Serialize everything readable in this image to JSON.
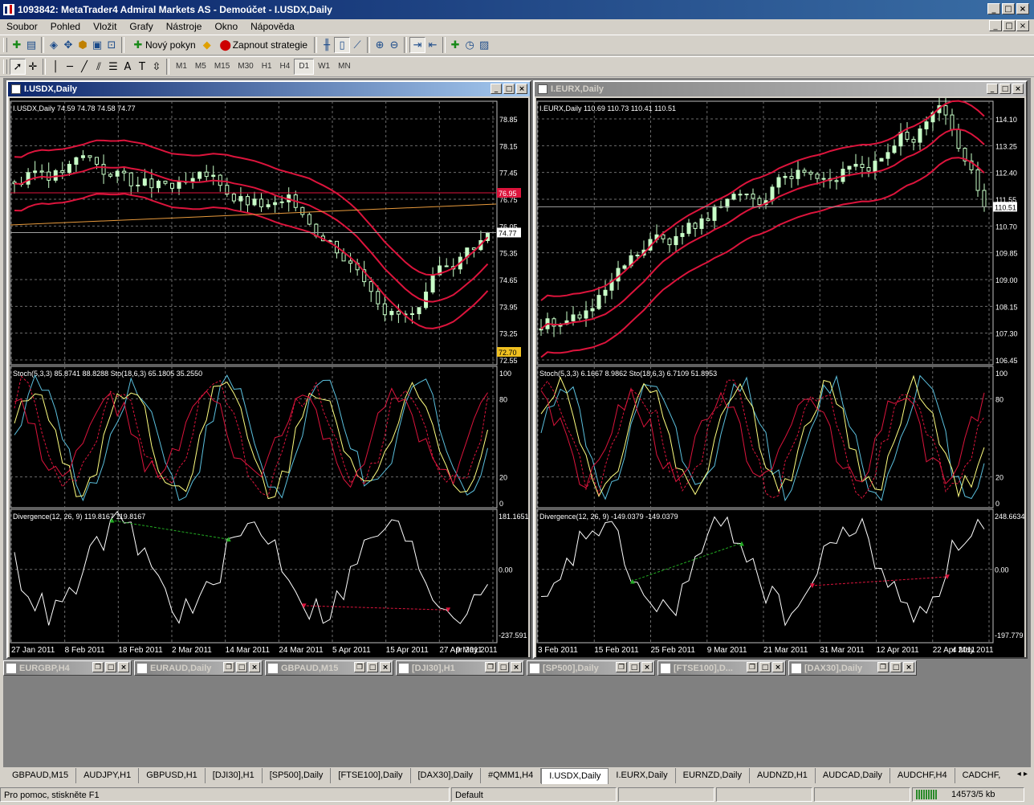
{
  "window": {
    "title": "1093842: MetaTrader4 Admiral Markets AS - Demoúčet - I.USDX,Daily"
  },
  "menu": [
    "Soubor",
    "Pohled",
    "Vložit",
    "Grafy",
    "Nástroje",
    "Okno",
    "Nápověda"
  ],
  "toolbar": {
    "new_order": "Nový pokyn",
    "strategy": "Zapnout strategie"
  },
  "drawing_toolbar": {
    "text_tool": "A"
  },
  "timeframes": [
    "M1",
    "M5",
    "M15",
    "M30",
    "H1",
    "H4",
    "D1",
    "W1",
    "MN"
  ],
  "active_timeframe": "D1",
  "charts": [
    {
      "title": "I.USDX,Daily",
      "state": "active",
      "header": "I.USDX,Daily  74.59 74.78 74.58 74.77",
      "price_levels": [
        "78.85",
        "78.15",
        "77.45",
        "76.75",
        "76.05",
        "75.35",
        "74.65",
        "73.95",
        "73.25",
        "72.55"
      ],
      "current_price": "74.77",
      "red_line_label": "76.95",
      "yellow_label": "72.70",
      "stoch_header": "Stoch(5,3,3) 85.8741 88.8288  Sto(18,6,3) 65.1805 35.2550",
      "stoch_levels": [
        "100",
        "80",
        "20",
        "0"
      ],
      "div_header": "Divergence(12, 26, 9) 119.8167 119.8167",
      "div_levels": [
        "181.1651",
        "0.00",
        "-237.591"
      ],
      "dates": [
        "27 Jan 2011",
        "8 Feb 2011",
        "18 Feb 2011",
        "2 Mar 2011",
        "14 Mar 2011",
        "24 Mar 2011",
        "5 Apr 2011",
        "15 Apr 2011",
        "27 Apr 2011",
        "9 May 2011"
      ]
    },
    {
      "title": "I.EURX,Daily",
      "state": "inactive",
      "header": "I.EURX,Daily  110.69 110.73 110.41 110.51",
      "price_levels": [
        "114.10",
        "113.25",
        "112.40",
        "111.55",
        "110.70",
        "109.85",
        "109.00",
        "108.15",
        "107.30",
        "106.45"
      ],
      "current_price": "110.51",
      "stoch_header": "Stoch(5,3,3) 6.1667 8.9862  Sto(18,6,3) 6.7109 51.8953",
      "stoch_levels": [
        "100",
        "80",
        "20",
        "0"
      ],
      "div_header": "Divergence(12, 26, 9) -149.0379 -149.0379",
      "div_levels": [
        "248.6634",
        "0.00",
        "-197.779"
      ],
      "dates": [
        "3 Feb 2011",
        "15 Feb 2011",
        "25 Feb 2011",
        "9 Mar 2011",
        "21 Mar 2011",
        "31 Mar 2011",
        "12 Apr 2011",
        "22 Apr 2011",
        "4 May 2011"
      ]
    }
  ],
  "minimized": [
    "EURGBP,H4",
    "EURAUD,Daily",
    "GBPAUD,M15",
    "[DJI30],H1",
    "[SP500],Daily",
    "[FTSE100],D...",
    "[DAX30],Daily"
  ],
  "tabs": [
    "GBPAUD,M15",
    "AUDJPY,H1",
    "GBPUSD,H1",
    "[DJI30],H1",
    "[SP500],Daily",
    "[FTSE100],Daily",
    "[DAX30],Daily",
    "#QMM1,H4",
    "I.USDX,Daily",
    "I.EURX,Daily",
    "EURNZD,Daily",
    "AUDNZD,H1",
    "AUDCAD,Daily",
    "AUDCHF,H4",
    "CADCHF,H"
  ],
  "active_tab": "I.USDX,Daily",
  "status": {
    "help": "Pro pomoc, stiskněte F1",
    "profile": "Default",
    "traffic": "14573/5 kb"
  },
  "colors": {
    "background": "#000000",
    "bull": "#c8ffc8",
    "bollinger": "#dc143c",
    "stoch_main": "#ffff80",
    "stoch_signal": "#5bc0de"
  }
}
